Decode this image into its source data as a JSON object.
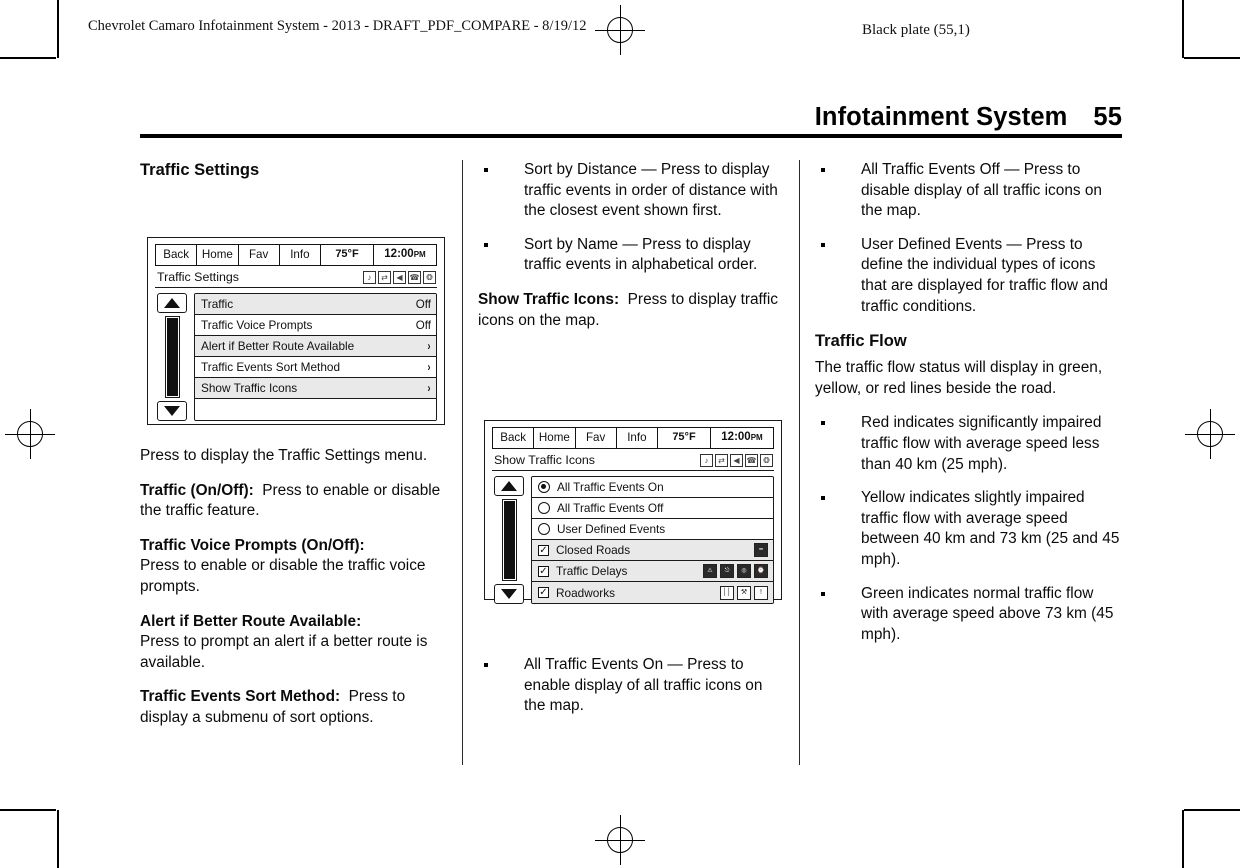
{
  "print_header": {
    "left": "Chevrolet Camaro Infotainment System - 2013 - DRAFT_PDF_COMPARE - 8/19/12",
    "right": "Black plate (55,1)"
  },
  "page": {
    "title": "Infotainment System",
    "number": "55"
  },
  "column1": {
    "heading": "Traffic Settings",
    "paragraphs": [
      {
        "bold": "",
        "text": "Press to display the Traffic Settings menu."
      },
      {
        "bold": "Traffic (On/Off):",
        "text": "Press to enable or disable the traffic feature."
      },
      {
        "bold": "Traffic Voice Prompts (On/Off):",
        "text": "Press to enable or disable the traffic voice prompts."
      },
      {
        "bold": "Alert if Better Route Available:",
        "text": "Press to prompt an alert if a better route is available."
      },
      {
        "bold": "Traffic Events Sort Method:",
        "text": "Press to display a submenu of sort options."
      }
    ]
  },
  "column2": {
    "bullets_top": [
      "Sort by Distance — Press to display traffic events in order of distance with the closest event shown first.",
      "Sort by Name — Press to display traffic events in alphabetical order."
    ],
    "paragraph": {
      "bold": "Show Traffic Icons:",
      "text": "Press to display traffic icons on the map."
    },
    "bullets_bottom": [
      "All Traffic Events On — Press to enable display of all traffic icons on the map."
    ]
  },
  "column3": {
    "bullets_top": [
      "All Traffic Events Off — Press to disable display of all traffic icons on the map.",
      "User Defined Events — Press to define the individual types of icons that are displayed for traffic flow and traffic conditions."
    ],
    "heading": "Traffic Flow",
    "paragraph": "The traffic flow status will display in green, yellow, or red lines beside the road.",
    "bullets_bottom": [
      "Red indicates significantly impaired traffic flow with average speed less than 40 km (25 mph).",
      "Yellow indicates slightly impaired traffic flow with average speed between 40 km and 73 km (25 and 45 mph).",
      "Green indicates normal traffic flow with average speed above 73 km (45 mph)."
    ]
  },
  "figure1": {
    "topbar": {
      "back": "Back",
      "home": "Home",
      "fav": "Fav",
      "info": "Info",
      "temp": "75°F",
      "time": "12:00",
      "ampm": "PM"
    },
    "screen_title": "Traffic Settings",
    "status_icons": [
      "mute-icon",
      "shuffle-icon",
      "speaker-icon",
      "phone-icon",
      "bluetooth-icon"
    ],
    "rows": [
      {
        "label": "Traffic",
        "value": "Off",
        "type": "value"
      },
      {
        "label": "Traffic Voice Prompts",
        "value": "Off",
        "type": "value"
      },
      {
        "label": "Alert if Better Route Available",
        "value": "›",
        "type": "chevron"
      },
      {
        "label": "Traffic Events Sort Method",
        "value": "›",
        "type": "chevron"
      },
      {
        "label": "Show Traffic Icons",
        "value": "›",
        "type": "chevron"
      },
      {
        "label": "",
        "value": "",
        "type": "blank"
      }
    ],
    "scroll_up": "up-arrow-icon",
    "scroll_down": "down-arrow-icon"
  },
  "figure2": {
    "topbar": {
      "back": "Back",
      "home": "Home",
      "fav": "Fav",
      "info": "Info",
      "temp": "75°F",
      "time": "12:00",
      "ampm": "PM"
    },
    "screen_title": "Show Traffic Icons",
    "status_icons": [
      "mute-icon",
      "shuffle-icon",
      "speaker-icon",
      "phone-icon",
      "bluetooth-icon"
    ],
    "rows": [
      {
        "label": "All Traffic Events On",
        "control": "radio-selected",
        "icons": []
      },
      {
        "label": "All Traffic Events Off",
        "control": "radio",
        "icons": []
      },
      {
        "label": "User Defined Events",
        "control": "radio",
        "icons": []
      },
      {
        "label": "Closed Roads",
        "control": "checkbox",
        "icons": [
          "closed-road-icon"
        ]
      },
      {
        "label": "Traffic Delays",
        "control": "checkbox",
        "icons": [
          "accident-icon",
          "car-icon",
          "congestion-icon",
          "hourglass-icon"
        ]
      },
      {
        "label": "Roadworks",
        "control": "checkbox",
        "icons": [
          "lane-closure-icon",
          "roadwork-digger-icon",
          "warning-icon"
        ]
      }
    ],
    "scroll_up": "up-arrow-icon",
    "scroll_down": "down-arrow-icon"
  }
}
